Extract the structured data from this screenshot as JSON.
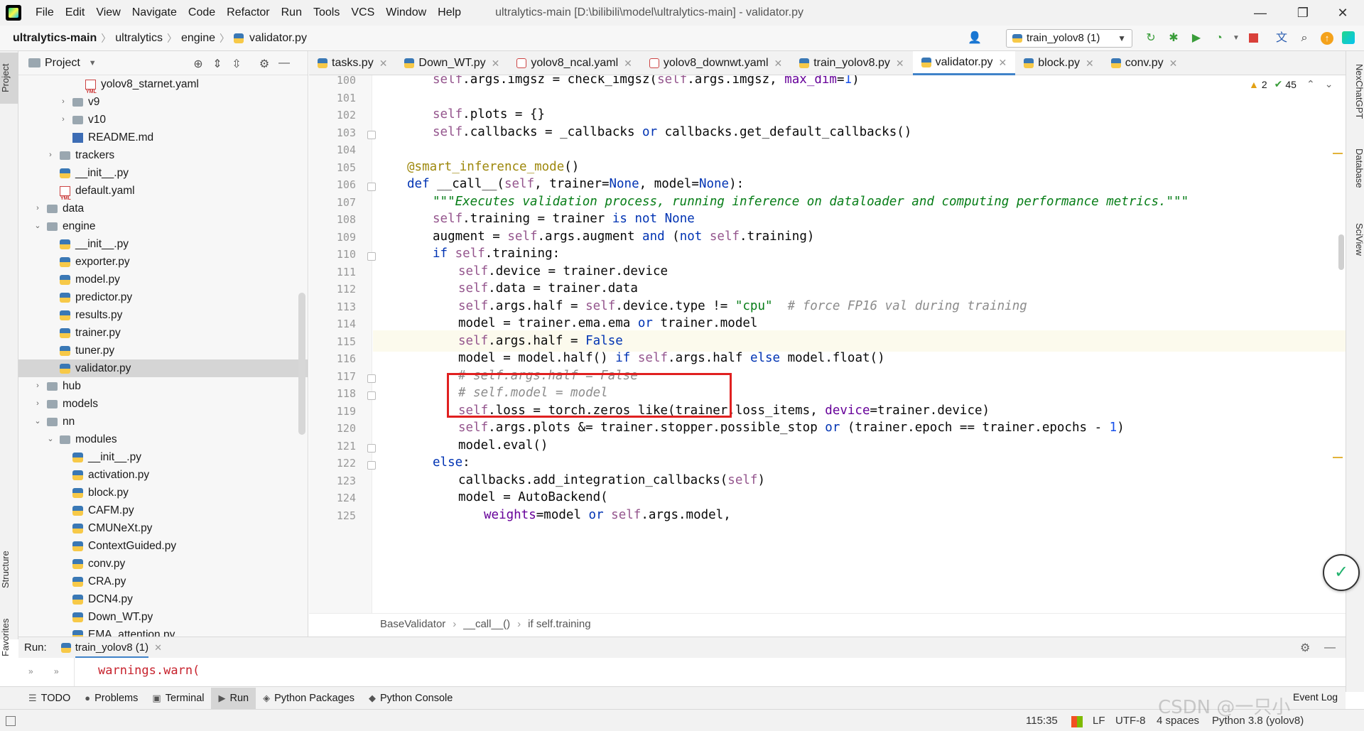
{
  "menu": [
    "File",
    "Edit",
    "View",
    "Navigate",
    "Code",
    "Refactor",
    "Run",
    "Tools",
    "VCS",
    "Window",
    "Help"
  ],
  "window_title": "ultralytics-main [D:\\bilibili\\model\\ultralytics-main] - validator.py",
  "window_controls": {
    "minimize": "—",
    "maximize": "❐",
    "close": "✕"
  },
  "breadcrumb": [
    "ultralytics-main",
    "ultralytics",
    "engine",
    "validator.py"
  ],
  "run_config": "train_yolov8 (1)",
  "left_stripe": {
    "project": "Project",
    "structure": "Structure",
    "favorites": "Favorites"
  },
  "right_stripe": [
    "NexChatGPT",
    "Database",
    "SciView"
  ],
  "project_panel": {
    "title": "Project"
  },
  "tree": [
    {
      "label": "yolov8_starnet.yaml",
      "icon": "yml",
      "depth": 6,
      "arrow": ""
    },
    {
      "label": "v9",
      "icon": "folder",
      "depth": 5,
      "arrow": "›"
    },
    {
      "label": "v10",
      "icon": "folder",
      "depth": 5,
      "arrow": "›"
    },
    {
      "label": "README.md",
      "icon": "md",
      "depth": 5,
      "arrow": ""
    },
    {
      "label": "trackers",
      "icon": "folder",
      "depth": 4,
      "arrow": "›"
    },
    {
      "label": "__init__.py",
      "icon": "py",
      "depth": 4,
      "arrow": ""
    },
    {
      "label": "default.yaml",
      "icon": "yml",
      "depth": 4,
      "arrow": ""
    },
    {
      "label": "data",
      "icon": "folder",
      "depth": 3,
      "arrow": "›"
    },
    {
      "label": "engine",
      "icon": "folder",
      "depth": 3,
      "arrow": "⌄"
    },
    {
      "label": "__init__.py",
      "icon": "py",
      "depth": 4,
      "arrow": ""
    },
    {
      "label": "exporter.py",
      "icon": "py",
      "depth": 4,
      "arrow": ""
    },
    {
      "label": "model.py",
      "icon": "py",
      "depth": 4,
      "arrow": ""
    },
    {
      "label": "predictor.py",
      "icon": "py",
      "depth": 4,
      "arrow": ""
    },
    {
      "label": "results.py",
      "icon": "py",
      "depth": 4,
      "arrow": ""
    },
    {
      "label": "trainer.py",
      "icon": "py",
      "depth": 4,
      "arrow": ""
    },
    {
      "label": "tuner.py",
      "icon": "py",
      "depth": 4,
      "arrow": ""
    },
    {
      "label": "validator.py",
      "icon": "py",
      "depth": 4,
      "arrow": "",
      "selected": true
    },
    {
      "label": "hub",
      "icon": "folder",
      "depth": 3,
      "arrow": "›"
    },
    {
      "label": "models",
      "icon": "folder",
      "depth": 3,
      "arrow": "›"
    },
    {
      "label": "nn",
      "icon": "folder",
      "depth": 3,
      "arrow": "⌄"
    },
    {
      "label": "modules",
      "icon": "folder",
      "depth": 4,
      "arrow": "⌄"
    },
    {
      "label": "__init__.py",
      "icon": "py",
      "depth": 5,
      "arrow": ""
    },
    {
      "label": "activation.py",
      "icon": "py",
      "depth": 5,
      "arrow": ""
    },
    {
      "label": "block.py",
      "icon": "py",
      "depth": 5,
      "arrow": ""
    },
    {
      "label": "CAFM.py",
      "icon": "py",
      "depth": 5,
      "arrow": ""
    },
    {
      "label": "CMUNeXt.py",
      "icon": "py",
      "depth": 5,
      "arrow": ""
    },
    {
      "label": "ContextGuided.py",
      "icon": "py",
      "depth": 5,
      "arrow": ""
    },
    {
      "label": "conv.py",
      "icon": "py",
      "depth": 5,
      "arrow": ""
    },
    {
      "label": "CRA.py",
      "icon": "py",
      "depth": 5,
      "arrow": ""
    },
    {
      "label": "DCN4.py",
      "icon": "py",
      "depth": 5,
      "arrow": ""
    },
    {
      "label": "Down_WT.py",
      "icon": "py",
      "depth": 5,
      "arrow": ""
    },
    {
      "label": "EMA_attention.py",
      "icon": "py",
      "depth": 5,
      "arrow": ""
    }
  ],
  "editor_tabs": [
    {
      "label": "tasks.py",
      "icon": "py"
    },
    {
      "label": "Down_WT.py",
      "icon": "py"
    },
    {
      "label": "yolov8_ncal.yaml",
      "icon": "yml"
    },
    {
      "label": "yolov8_downwt.yaml",
      "icon": "yml"
    },
    {
      "label": "train_yolov8.py",
      "icon": "py"
    },
    {
      "label": "validator.py",
      "icon": "py",
      "active": true
    },
    {
      "label": "block.py",
      "icon": "py"
    },
    {
      "label": "conv.py",
      "icon": "py"
    }
  ],
  "inspections": {
    "warnings": "2",
    "ok": "45"
  },
  "code_lines": [
    {
      "n": "100",
      "indent": 2,
      "html": "<span class=\"c-self\">self</span>.args.imgsz = check_imgsz(<span class=\"c-self\">self</span>.args.imgsz, <span class=\"c-param\">max_dim</span>=<span class=\"c-num\">1</span>)"
    },
    {
      "n": "101",
      "indent": 0,
      "html": ""
    },
    {
      "n": "102",
      "indent": 2,
      "html": "<span class=\"c-self\">self</span>.plots = {}"
    },
    {
      "n": "103",
      "indent": 2,
      "html": "<span class=\"c-self\">self</span>.callbacks = _callbacks <span class=\"c-kw\">or</span> callbacks.get_default_callbacks()"
    },
    {
      "n": "104",
      "indent": 0,
      "html": ""
    },
    {
      "n": "105",
      "indent": 1,
      "html": "<span class=\"c-dec\">@smart_inference_mode</span>()"
    },
    {
      "n": "106",
      "indent": 1,
      "html": "<span class=\"c-kw\">def</span> __call__(<span class=\"c-self\">self</span>, trainer=<span class=\"c-kw\">None</span>, model=<span class=\"c-kw\">None</span>):"
    },
    {
      "n": "107",
      "indent": 2,
      "html": "<span class=\"c-doc\">\"\"\"Executes validation process, running inference on dataloader and computing performance metrics.\"\"\"</span>"
    },
    {
      "n": "108",
      "indent": 2,
      "html": "<span class=\"c-self\">self</span>.training = trainer <span class=\"c-kw\">is not None</span>"
    },
    {
      "n": "109",
      "indent": 2,
      "html": "augment = <span class=\"c-self\">self</span>.args.augment <span class=\"c-kw\">and</span> (<span class=\"c-kw\">not</span> <span class=\"c-self\">self</span>.training)"
    },
    {
      "n": "110",
      "indent": 2,
      "html": "<span class=\"c-kw\">if</span> <span class=\"c-self\">self</span>.training:"
    },
    {
      "n": "111",
      "indent": 3,
      "html": "<span class=\"c-self\">self</span>.device = trainer.device"
    },
    {
      "n": "112",
      "indent": 3,
      "html": "<span class=\"c-self\">self</span>.data = trainer.data"
    },
    {
      "n": "113",
      "indent": 3,
      "html": "<span class=\"c-self\">self</span>.args.half = <span class=\"c-self\">self</span>.device.type != <span class=\"c-str\">\"cpu\"</span>  <span class=\"c-cmt\"># force FP16 val during training</span>"
    },
    {
      "n": "114",
      "indent": 3,
      "html": "model = trainer.ema.ema <span class=\"c-kw\">or</span> trainer.model"
    },
    {
      "n": "115",
      "indent": 3,
      "html": "<span class=\"c-self\">self</span>.args.half = <span class=\"c-kw\">False</span>",
      "current": true
    },
    {
      "n": "116",
      "indent": 3,
      "html": "model = model.half() <span class=\"c-kw\">if</span> <span class=\"c-self\">self</span>.args.half <span class=\"c-kw\">else</span> model.float()"
    },
    {
      "n": "117",
      "indent": 3,
      "html": "<span class=\"c-cmt\"># self.args.half = False</span>"
    },
    {
      "n": "118",
      "indent": 3,
      "html": "<span class=\"c-cmt\"># self.model = model</span>"
    },
    {
      "n": "119",
      "indent": 3,
      "html": "<span class=\"c-self\">self</span>.loss = torch.zeros_like(trainer.loss_items, <span class=\"c-param\">device</span>=trainer.device)"
    },
    {
      "n": "120",
      "indent": 3,
      "html": "<span class=\"c-self\">self</span>.args.plots &amp;= trainer.stopper.possible_stop <span class=\"c-kw\">or</span> (trainer.epoch == trainer.epochs - <span class=\"c-num\">1</span>)"
    },
    {
      "n": "121",
      "indent": 3,
      "html": "model.eval()"
    },
    {
      "n": "122",
      "indent": 2,
      "html": "<span class=\"c-kw\">else</span>:"
    },
    {
      "n": "123",
      "indent": 3,
      "html": "callbacks.add_integration_callbacks(<span class=\"c-self\">self</span>)"
    },
    {
      "n": "124",
      "indent": 3,
      "html": "model = AutoBackend("
    },
    {
      "n": "125",
      "indent": 4,
      "html": "<span class=\"c-param\">weights</span>=model <span class=\"c-kw\">or</span> <span class=\"c-self\">self</span>.args.model,"
    }
  ],
  "code_breadcrumb": [
    "BaseValidator",
    "__call__()",
    "if self.training"
  ],
  "run_panel": {
    "label": "Run:",
    "tab": "train_yolov8 (1)",
    "output": "warnings.warn("
  },
  "tool_windows": [
    {
      "label": "TODO",
      "icon": "☰"
    },
    {
      "label": "Problems",
      "icon": "●"
    },
    {
      "label": "Terminal",
      "icon": "▣"
    },
    {
      "label": "Run",
      "icon": "▶",
      "active": true
    },
    {
      "label": "Python Packages",
      "icon": "◈"
    },
    {
      "label": "Python Console",
      "icon": "◆"
    }
  ],
  "event_log": "Event Log",
  "status": {
    "position": "115:35",
    "line_sep": "LF",
    "encoding": "UTF-8",
    "indent": "4 spaces",
    "interpreter": "Python 3.8 (yolov8)"
  },
  "watermark": "CSDN @一只小"
}
